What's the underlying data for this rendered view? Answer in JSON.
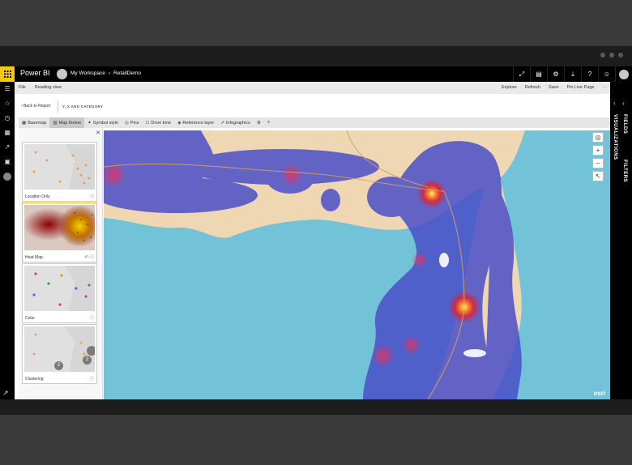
{
  "app": {
    "name": "Power BI",
    "workspace": "My Workspace",
    "report": "RetailDemo"
  },
  "cmdbar": {
    "file": "File",
    "reading_view": "Reading view",
    "explore": "Explore",
    "refresh": "Refresh",
    "save": "Save",
    "pin_live_page": "Pin Live Page",
    "more": "···"
  },
  "page": {
    "back": "Back to Report",
    "visual_title": "Y, X AND CATEGORY"
  },
  "toolbar": {
    "basemap": "Basemap",
    "map_theme": "Map theme",
    "symbol_style": "Symbol style",
    "pins": "Pins",
    "drive_time": "Drive time",
    "reference_layer": "Reference layer",
    "infographics": "Infographics"
  },
  "themes": [
    {
      "label": "Location Only"
    },
    {
      "label": "Heat Map"
    },
    {
      "label": "Color"
    },
    {
      "label": "Clustering",
      "cluster_a": "2",
      "cluster_b": "2"
    }
  ],
  "right_rail": {
    "fields": "FIELDS",
    "visualizations": "VISUALIZATIONS",
    "filters": "FILTERS"
  },
  "map": {
    "attribution": "esri"
  },
  "colors": {
    "accent": "#f2c811",
    "topbar": "#000000",
    "heat_blue": "#4a4fc8",
    "water": "#72c2d8",
    "land": "#f0d7b4"
  },
  "icons": [
    "waffle-icon",
    "avatar-icon",
    "chevron-right-icon",
    "expand-icon",
    "comment-icon",
    "gear-icon",
    "download-icon",
    "help-icon",
    "feedback-icon",
    "hamburger-icon",
    "star-icon",
    "clock-icon",
    "apps-icon",
    "share-icon",
    "workspaces-icon",
    "locate-icon",
    "zoom-in-icon",
    "zoom-out-icon",
    "select-icon"
  ]
}
